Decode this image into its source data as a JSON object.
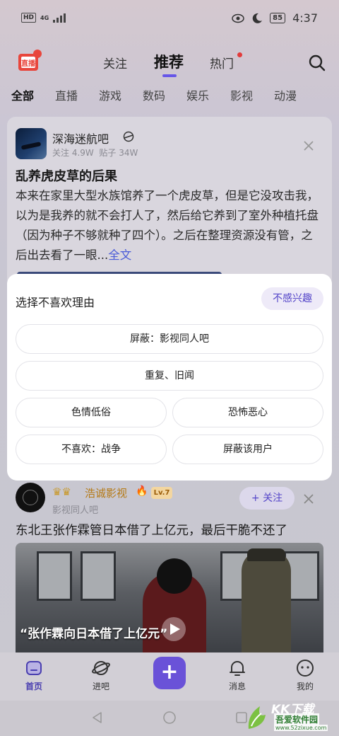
{
  "status_bar": {
    "left_badge": "HD",
    "network": "4G",
    "battery": "85",
    "time": "4:37"
  },
  "top_nav": {
    "tabs": [
      {
        "label": "关注"
      },
      {
        "label": "推荐"
      },
      {
        "label": "热门"
      }
    ],
    "active_tab": "推荐",
    "logo_text": "直播"
  },
  "categories": [
    "全部",
    "直播",
    "游戏",
    "数码",
    "娱乐",
    "影视",
    "动漫"
  ],
  "post1": {
    "forum_name": "深海迷航吧",
    "followers": "关注 4.9W",
    "posts": "贴子 34W",
    "title": "乱养虎皮草的后果",
    "body": "本来在家里大型水族馆养了一个虎皮草，但是它没攻击我，以为是我养的就不会打人了，然后给它养到了室外种植托盘（因为种子不够就种了四个）。之后在整理资源没有管，之后出去看了一眼...",
    "full_text_link": "全文"
  },
  "popup": {
    "title": "选择不喜欢理由",
    "not_interested": "不感兴趣",
    "reasons": [
      "屏蔽：影视同人吧",
      "重复、旧闻",
      "色情低俗",
      "恐怖恶心",
      "不喜欢：战争",
      "屏蔽该用户"
    ]
  },
  "post2": {
    "username": "浩诚影视",
    "level": "Lv.7",
    "forum": "影视同人吧",
    "follow_label": "+ 关注",
    "title": "东北王张作霖管日本借了上亿元，最后干脆不还了",
    "video_caption": "“张作霖向日本借了上亿元”"
  },
  "bottom_nav": [
    {
      "label": "首页",
      "icon": "home-icon"
    },
    {
      "label": "进吧",
      "icon": "planet-icon"
    },
    {
      "label": "+",
      "icon": "plus-icon"
    },
    {
      "label": "消息",
      "icon": "bell-icon"
    },
    {
      "label": "我的",
      "icon": "face-icon"
    }
  ],
  "watermark": {
    "big": "KK下载",
    "mid": "吾爱软件园",
    "url": "www.52zixue.com"
  },
  "colors": {
    "accent": "#5546c9",
    "hot_dot": "#e23b3b",
    "link": "#4a5bd8"
  }
}
